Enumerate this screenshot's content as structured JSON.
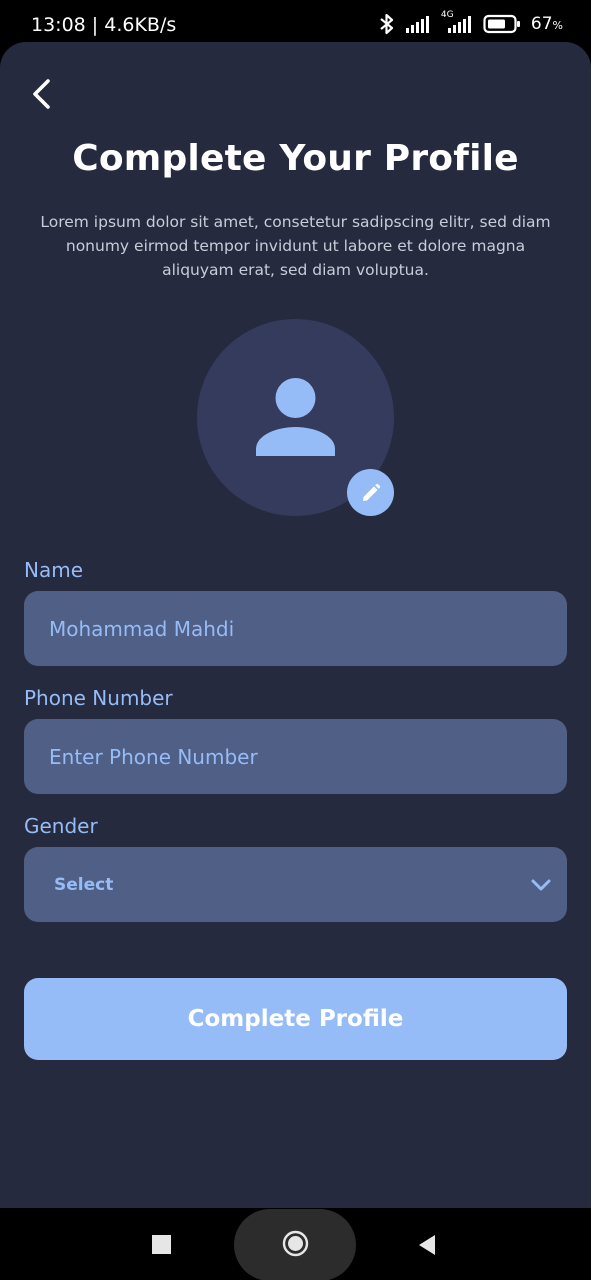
{
  "status": {
    "time_speed": "13:08 | 4.6KB/s",
    "battery": "67",
    "battery_unit": "%",
    "network_label": "4G"
  },
  "page": {
    "title": "Complete Your Profile",
    "subtitle": "Lorem ipsum dolor sit amet, consetetur sadipscing elitr, sed diam nonumy eirmod tempor invidunt ut labore et dolore magna aliquyam erat, sed diam voluptua."
  },
  "form": {
    "name_label": "Name",
    "name_value": "Mohammad Mahdi",
    "phone_label": "Phone Number",
    "phone_placeholder": "Enter Phone Number",
    "gender_label": "Gender",
    "gender_value": "Select"
  },
  "actions": {
    "submit_label": "Complete Profile"
  },
  "colors": {
    "background": "#252a3e",
    "accent": "#96bcf7",
    "field": "#4f5f85",
    "avatar": "#343b5c"
  },
  "icons": [
    "back-arrow-icon",
    "person-icon",
    "pencil-icon",
    "chevron-down-icon",
    "bluetooth-icon",
    "signal-icon",
    "battery-icon"
  ]
}
